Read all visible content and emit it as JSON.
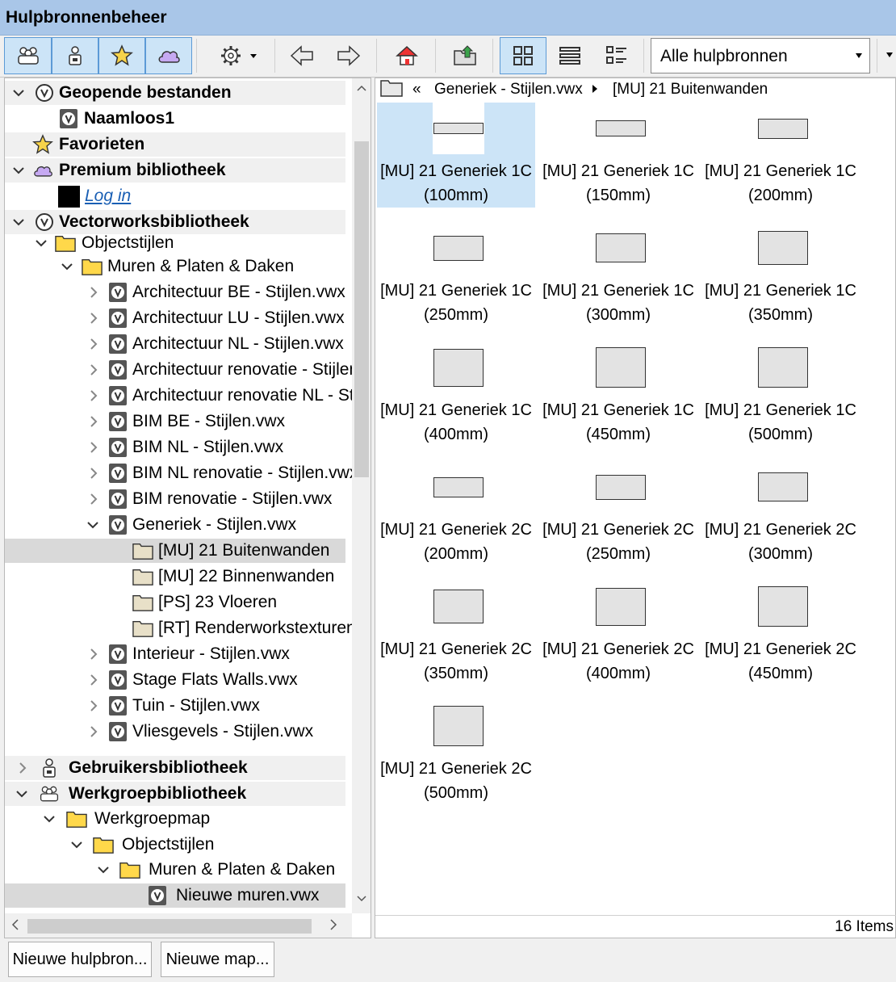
{
  "window": {
    "title": "Hulpbronnenbeheer"
  },
  "toolbar": {
    "buttons": [
      {
        "name": "workgroup-library-button",
        "icon": "group-people-icon"
      },
      {
        "name": "user-library-button",
        "icon": "user-lock-icon"
      },
      {
        "name": "favorites-button",
        "icon": "star-icon"
      },
      {
        "name": "cloud-library-button",
        "icon": "cloud-icon"
      },
      {
        "name": "settings-button",
        "icon": "gear-icon"
      },
      {
        "name": "back-button",
        "icon": "arrow-left-icon"
      },
      {
        "name": "forward-button",
        "icon": "arrow-right-icon"
      },
      {
        "name": "home-button",
        "icon": "home-icon"
      },
      {
        "name": "import-button",
        "icon": "folder-import-icon"
      },
      {
        "name": "view-grid-button",
        "icon": "grid-view-icon"
      },
      {
        "name": "view-list-button",
        "icon": "list-view-icon"
      },
      {
        "name": "view-details-button",
        "icon": "detail-view-icon"
      }
    ],
    "library_filter": "Alle hulpbronnen"
  },
  "tree": {
    "open_files_header": "Geopende bestanden",
    "open_file": "Naamloos1",
    "favorites_header": "Favorieten",
    "premium_header": "Premium bibliotheek",
    "login_link": "Log in",
    "vw_library_header": "Vectorworksbibliotheek",
    "folder_object_styles": "Objectstijlen",
    "folder_walls": "Muren & Platen & Daken",
    "files": [
      "Architectuur BE - Stijlen.vwx",
      "Architectuur LU - Stijlen.vwx",
      "Architectuur NL - Stijlen.vwx",
      "Architectuur renovatie - Stijlen.vwx",
      "Architectuur renovatie NL - Stijlen.vwx",
      "BIM BE - Stijlen.vwx",
      "BIM NL - Stijlen.vwx",
      "BIM NL renovatie - Stijlen.vwx",
      "BIM renovatie - Stijlen.vwx",
      "Generiek - Stijlen.vwx"
    ],
    "generic_subfolders": [
      "[MU] 21 Buitenwanden",
      "[MU] 22 Binnenwanden",
      "[PS] 23 Vloeren",
      "[RT] Renderworkstexturen"
    ],
    "files_after": [
      "Interieur - Stijlen.vwx",
      "Stage Flats Walls.vwx",
      "Tuin - Stijlen.vwx",
      "Vliesgevels - Stijlen.vwx"
    ],
    "user_library_header": "Gebruikersbibliotheek",
    "workgroup_library_header": "Werkgroepbibliotheek",
    "workgroup_folder": "Werkgroepmap",
    "workgroup_object_styles": "Objectstijlen",
    "workgroup_walls": "Muren & Platen & Daken",
    "workgroup_file": "Nieuwe muren.vwx"
  },
  "breadcrumb": {
    "back": "«",
    "file": "Generiek - Stijlen.vwx",
    "folder": "[MU] 21 Buitenwanden"
  },
  "resources": [
    {
      "name": "[MU] 21 Generiek 1C",
      "size": "(100mm)",
      "thickness_mm": 100
    },
    {
      "name": "[MU] 21 Generiek 1C",
      "size": "(150mm)",
      "thickness_mm": 150
    },
    {
      "name": "[MU] 21 Generiek 1C",
      "size": "(200mm)",
      "thickness_mm": 200
    },
    {
      "name": "[MU] 21 Generiek 1C",
      "size": "(250mm)",
      "thickness_mm": 250
    },
    {
      "name": "[MU] 21 Generiek 1C",
      "size": "(300mm)",
      "thickness_mm": 300
    },
    {
      "name": "[MU] 21 Generiek 1C",
      "size": "(350mm)",
      "thickness_mm": 350
    },
    {
      "name": "[MU] 21 Generiek 1C",
      "size": "(400mm)",
      "thickness_mm": 400
    },
    {
      "name": "[MU] 21 Generiek 1C",
      "size": "(450mm)",
      "thickness_mm": 450
    },
    {
      "name": "[MU] 21 Generiek 1C",
      "size": "(500mm)",
      "thickness_mm": 500
    },
    {
      "name": "[MU] 21 Generiek 2C",
      "size": "(200mm)",
      "thickness_mm": 200
    },
    {
      "name": "[MU] 21 Generiek 2C",
      "size": "(250mm)",
      "thickness_mm": 250
    },
    {
      "name": "[MU] 21 Generiek 2C",
      "size": "(300mm)",
      "thickness_mm": 300
    },
    {
      "name": "[MU] 21 Generiek 2C",
      "size": "(350mm)",
      "thickness_mm": 350
    },
    {
      "name": "[MU] 21 Generiek 2C",
      "size": "(400mm)",
      "thickness_mm": 400
    },
    {
      "name": "[MU] 21 Generiek 2C",
      "size": "(450mm)",
      "thickness_mm": 450
    },
    {
      "name": "[MU] 21 Generiek 2C",
      "size": "(500mm)",
      "thickness_mm": 500
    }
  ],
  "status": {
    "count": "16 Items"
  },
  "bottom_buttons": {
    "new_resource": "Nieuwe hulpbron...",
    "new_folder": "Nieuwe map..."
  }
}
